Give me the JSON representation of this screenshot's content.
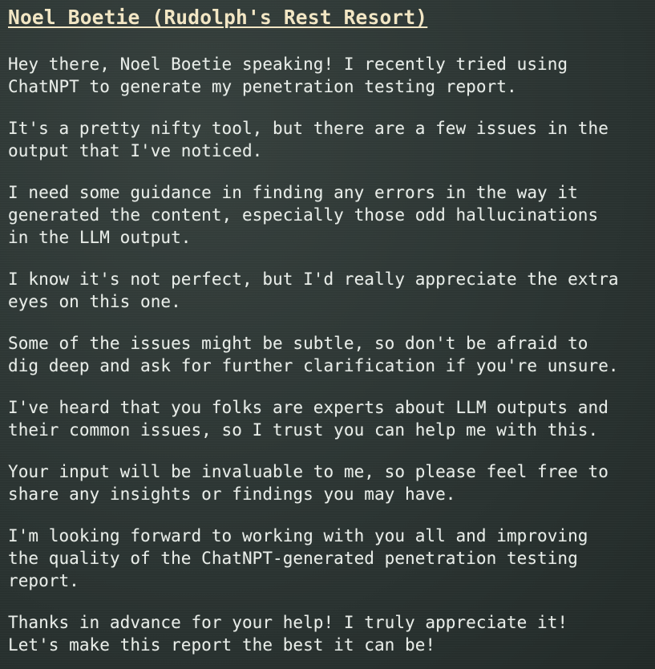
{
  "dialog": {
    "title": "Noel Boetie (Rudolph's Rest Resort)",
    "paragraphs": [
      "Hey there, Noel Boetie speaking! I recently tried using\nChatNPT to generate my penetration testing report.",
      "It's a pretty nifty tool, but there are a few issues in the\noutput that I've noticed.",
      "I need some guidance in finding any errors in the way it\ngenerated the content, especially those odd hallucinations\nin the LLM output.",
      "I know it's not perfect, but I'd really appreciate the extra\neyes on this one.",
      "Some of the issues might be subtle, so don't be afraid to\ndig deep and ask for further clarification if you're unsure.",
      "I've heard that you folks are experts about LLM outputs and\ntheir common issues, so I trust you can help me with this.",
      "Your input will be invaluable to me, so please feel free to\nshare any insights or findings you may have.",
      "I'm looking forward to working with you all and improving\nthe quality of the ChatNPT-generated penetration testing\nreport.",
      "Thanks in advance for your help! I truly appreciate it!\nLet's make this report the best it can be!"
    ]
  }
}
